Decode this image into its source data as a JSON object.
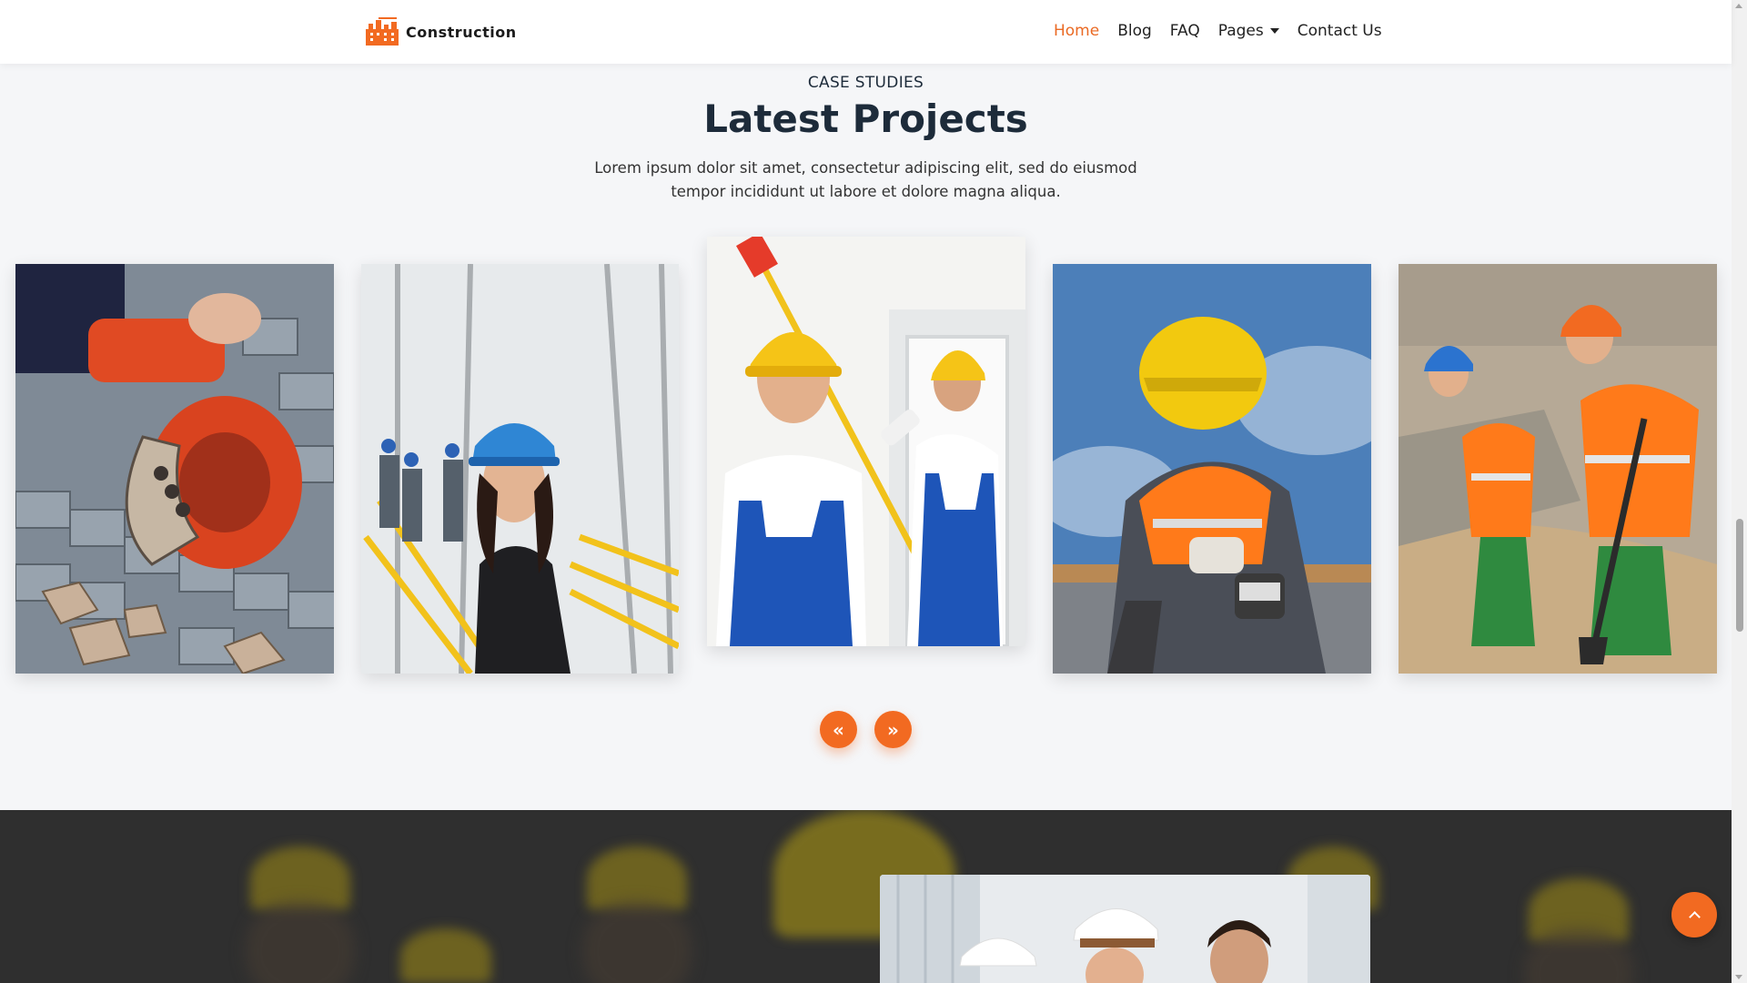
{
  "header": {
    "brand_name": "Construction",
    "logo_icon": "crane-city-logo",
    "nav": [
      {
        "label": "Home",
        "active": true
      },
      {
        "label": "Blog",
        "active": false
      },
      {
        "label": "FAQ",
        "active": false
      },
      {
        "label": "Pages",
        "active": false,
        "has_dropdown": true
      },
      {
        "label": "Contact Us",
        "active": false
      }
    ]
  },
  "section": {
    "eyebrow": "CASE STUDIES",
    "title": "Latest Projects",
    "description": "Lorem ipsum dolor sit amet, consectetur adipiscing elit, sed do eiusmod tempor incididunt ut labore et dolore magna aliqua."
  },
  "carousel": {
    "prev_icon": "double-chevron-left-icon",
    "next_icon": "double-chevron-right-icon",
    "prev_glyph": "«",
    "next_glyph": "»",
    "slides": [
      {
        "name": "worker-cutting-paving-stones-photo"
      },
      {
        "name": "woman-blue-hardhat-photo"
      },
      {
        "name": "painters-with-roller-photo"
      },
      {
        "name": "worker-angle-grinder-photo"
      },
      {
        "name": "road-workers-digging-photo"
      }
    ]
  },
  "colors": {
    "accent": "#f26a21",
    "nav_active": "#ea6a24",
    "heading": "#1d2b3a",
    "dark_section": "#2f2f2f"
  },
  "back_to_top_icon": "chevron-up-icon"
}
